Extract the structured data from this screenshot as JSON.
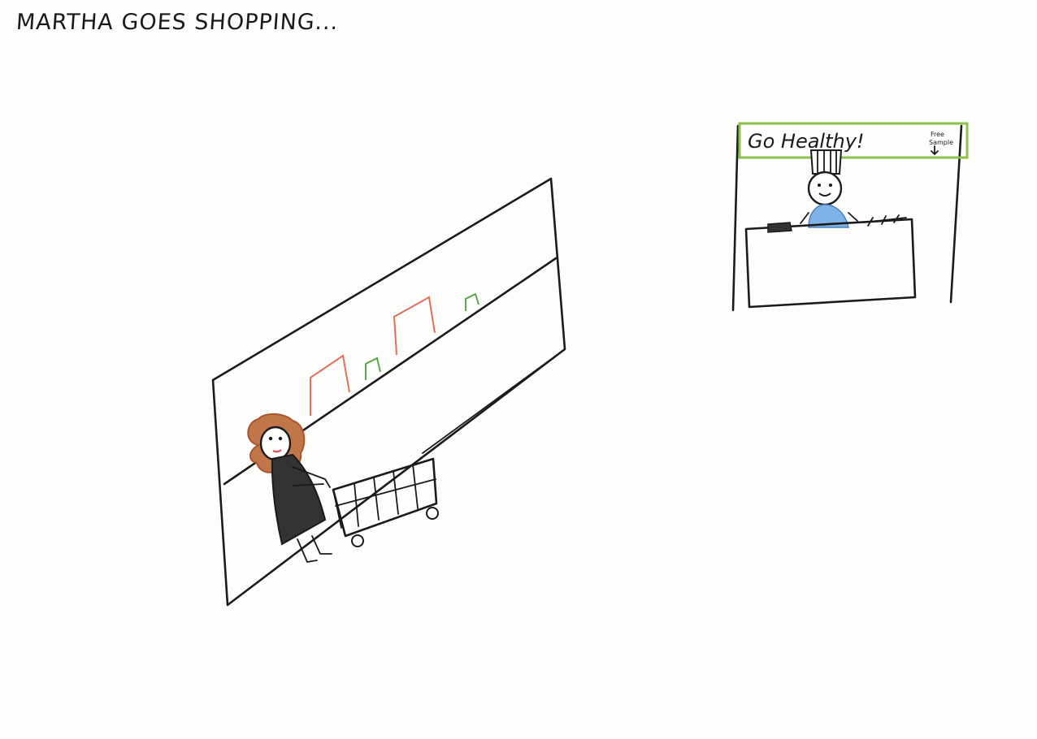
{
  "title": "MARTHA GOES SHOPPING...",
  "sign": {
    "main_text": "Go Healthy!",
    "small_text_line1": "Free",
    "small_text_line2": "Sample"
  },
  "colors": {
    "ink": "#1b1b1b",
    "product_red": "#e0705a",
    "product_green": "#5aa84a",
    "sign_green": "#8cc04a",
    "vendor_shirt": "#7fb3e8",
    "hair": "#b4643c",
    "lips": "#e05060"
  }
}
